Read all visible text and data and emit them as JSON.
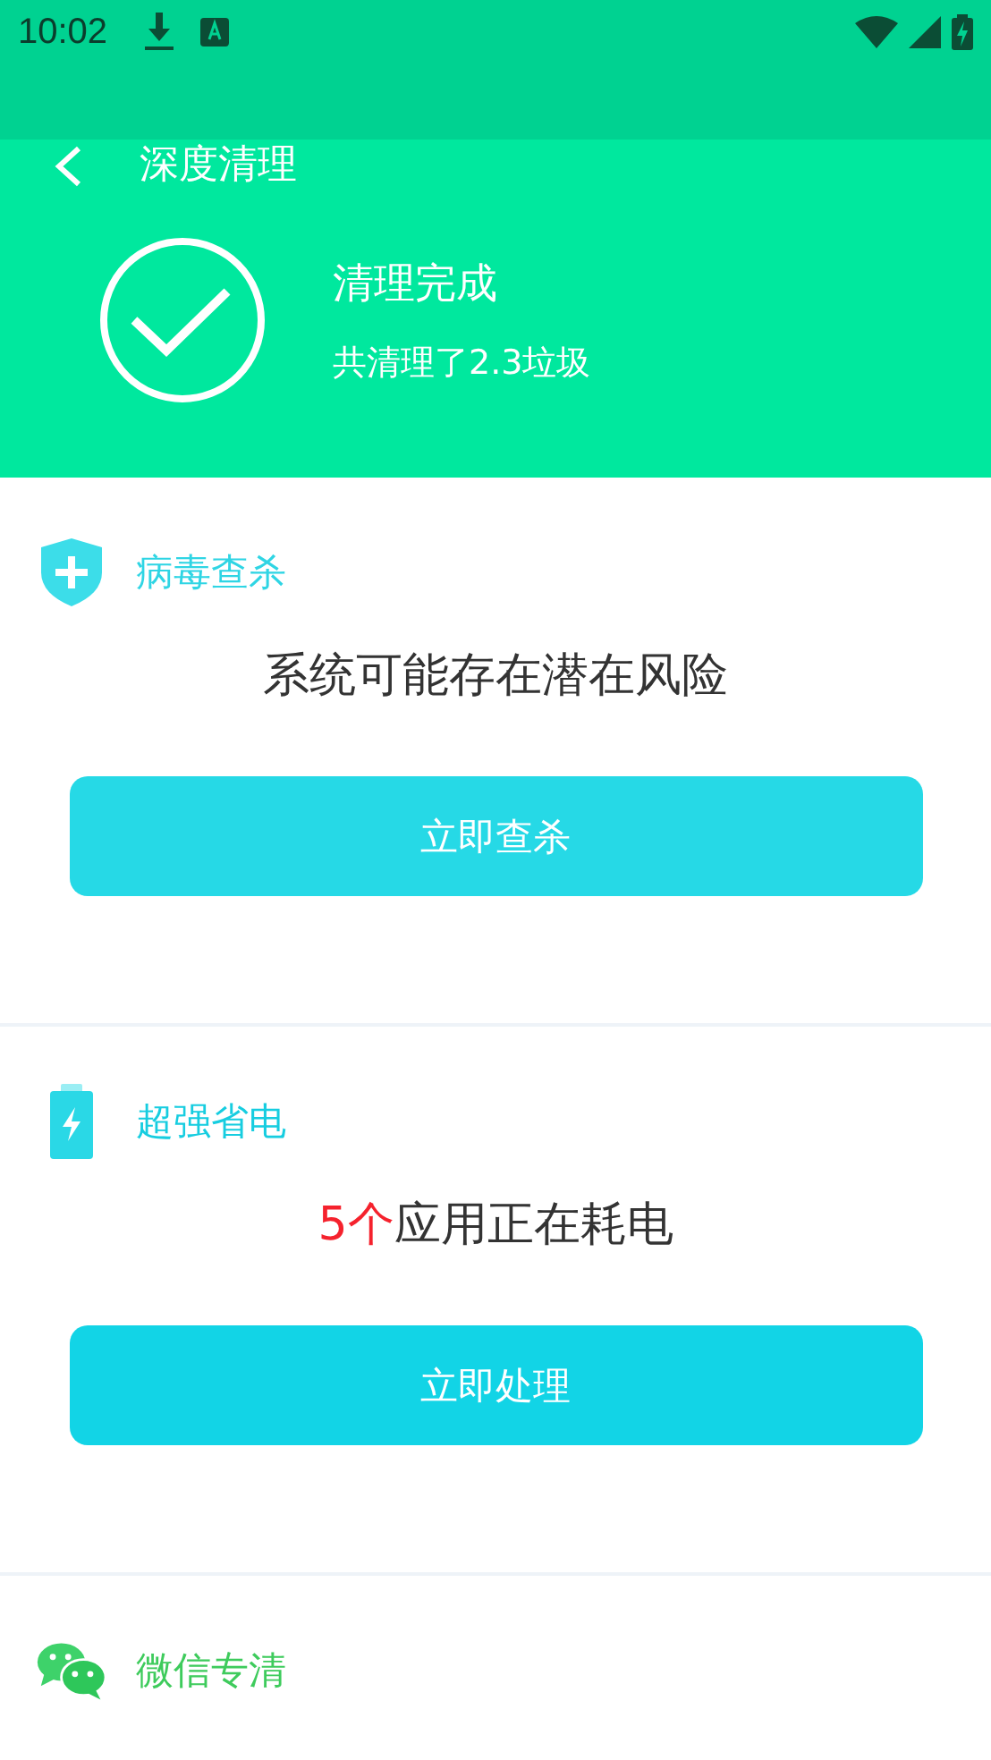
{
  "status_bar": {
    "time": "10:02"
  },
  "header": {
    "title": "深度清理",
    "result_title": "清理完成",
    "result_detail": "共清理了2.3垃圾"
  },
  "sections": [
    {
      "kind": "shield",
      "title": "病毒查杀",
      "message": {
        "text": "系统可能存在潜在风险"
      },
      "button": "立即查杀"
    },
    {
      "kind": "battery",
      "title": "超强省电",
      "message": {
        "highlight": "5个",
        "text": "应用正在耗电"
      },
      "button": "立即处理"
    },
    {
      "kind": "chat",
      "title": "微信专清"
    }
  ]
}
